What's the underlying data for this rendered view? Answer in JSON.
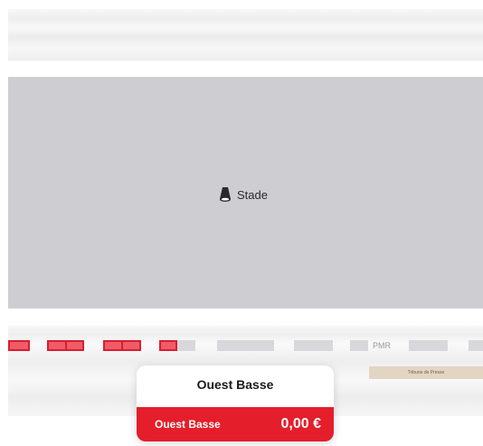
{
  "pitch": {
    "label": "Stade",
    "icon": "lamp-icon"
  },
  "seat_map": {
    "pmr_label": "PMR",
    "press_label": "Tribune de Presse"
  },
  "popup": {
    "title": "Ouest Basse",
    "zone_name": "Ouest Basse",
    "price": "0,00 €",
    "accent_color": "#e41e2b"
  }
}
